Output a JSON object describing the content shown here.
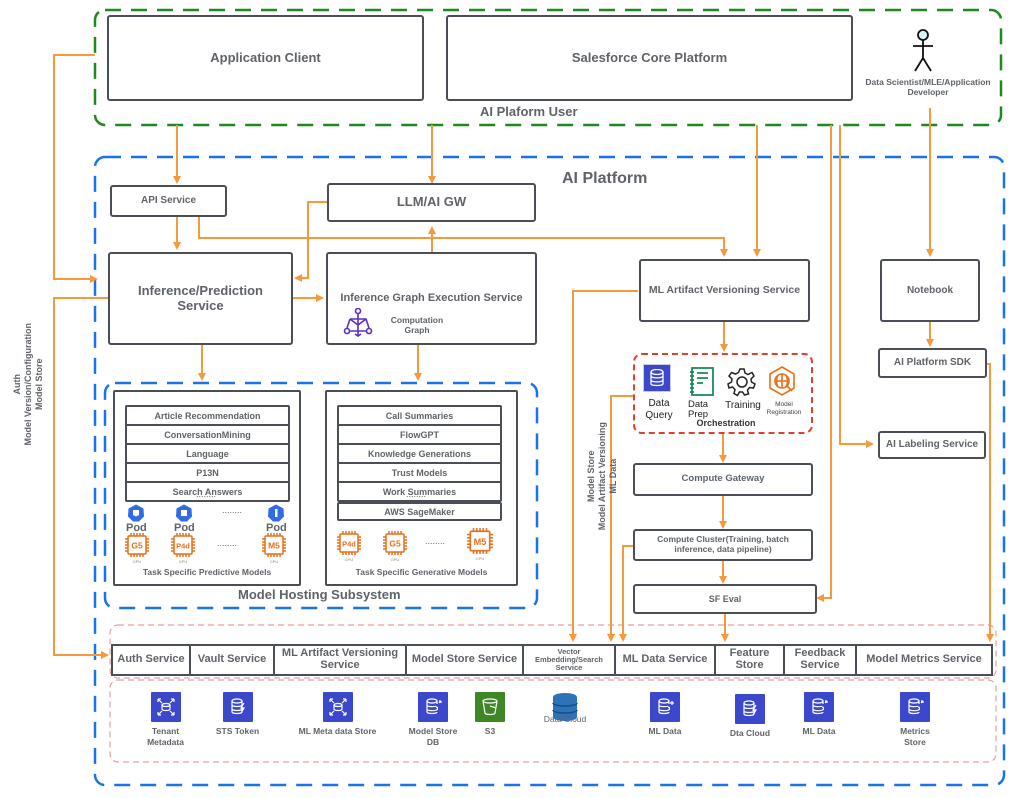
{
  "colors": {
    "user_boundary": "#1e8a1e",
    "platform_boundary": "#1a73e8",
    "connector": "#f7993a",
    "orchestration_border": "#e0402a",
    "data_layer_border": "#e8a0a0",
    "box_border": "#4a4f57",
    "text": "#5f6368",
    "aws_blue": "#3b48cc",
    "aws_green": "#3f8624",
    "chip_orange": "#e8701a",
    "pod_blue": "#326ce5",
    "graph_purple": "#5a2ec5"
  },
  "user_zone": {
    "title": "AI Plaform User",
    "application_client": "Application Client",
    "salesforce_core": "Salesforce Core Platform",
    "actor_icon": "person-icon",
    "actor_label": "Data Scientist/MLE/Application Developer"
  },
  "platform": {
    "title": "AI Platform",
    "api_service": "API Service",
    "llm_gw": "LLM/AI GW",
    "inference_service": "Inference/Prediction Service",
    "graph_execution": "Inference Graph Execution Service",
    "computation_graph_icon": "computation-graph-icon",
    "computation_graph": "Computation Graph",
    "ml_artifact_versioning": "ML Artifact Versioning Service",
    "notebook": "Notebook",
    "sdk": "AI Platform SDK",
    "labeling": "AI Labeling Service",
    "orchestration": {
      "title": "Orchestration",
      "items": [
        {
          "icon": "database-icon",
          "label": "Data Query"
        },
        {
          "icon": "notebook-icon",
          "label": "Data Prep"
        },
        {
          "icon": "gear-icon",
          "label": "Training"
        },
        {
          "icon": "model-registration-icon",
          "label": "Model Registration"
        }
      ]
    },
    "compute_gateway": "Compute Gateway",
    "compute_cluster": "Compute Cluster(Training, batch inference, data pipeline)",
    "sf_eval": "SF Eval"
  },
  "model_hosting": {
    "title": "Model Hosting Subsystem",
    "predictive": {
      "title": "Task Specific Predictive Models",
      "models": [
        "Article Recommendation",
        "ConversationMining",
        "Language",
        "P13N",
        "Search Answers"
      ],
      "ellipsis": "........",
      "pods": [
        "Pod",
        "Pod",
        "Pod"
      ],
      "chips": [
        {
          "name": "G5",
          "sub": "GPU"
        },
        {
          "name": "P4d",
          "sub": "GPU"
        },
        {
          "name": "M5",
          "sub": "CPU"
        }
      ]
    },
    "generative": {
      "title": "Task Specific Generative Models",
      "models": [
        "Call Summaries",
        "FlowGPT",
        "Knowledge Generations",
        "Trust Models",
        "Work Summaries"
      ],
      "ellipsis": "........",
      "sagemaker": "AWS SageMaker",
      "chips": [
        {
          "name": "P4d",
          "sub": "GPU"
        },
        {
          "name": "G5",
          "sub": "GPU"
        },
        {
          "name": "M5",
          "sub": "CPU"
        }
      ]
    }
  },
  "side_labels": {
    "left": [
      "Auth",
      "Model Version/Configuration",
      "Model Store"
    ],
    "middle": [
      "Model Store",
      "Model Artifact Versioning",
      "ML Data"
    ]
  },
  "services": [
    "Auth Service",
    "Vault Service",
    "ML Artifact Versioning Service",
    "Model Store Service",
    "Vector Embedding/Search Service",
    "ML Data Service",
    "Feature Store",
    "Feedback Service",
    "Model Metrics Service"
  ],
  "stores": [
    {
      "icon": "tenant-metadata-icon",
      "label": "Tenant Metadata"
    },
    {
      "icon": "sts-token-icon",
      "label": "STS Token"
    },
    {
      "icon": "ml-metadata-store-icon",
      "label": "ML Meta data Store"
    },
    {
      "icon": "model-store-db-icon",
      "label": "Model Store DB"
    },
    {
      "icon": "s3-bucket-icon",
      "label": "S3"
    },
    {
      "icon": "data-cloud-icon",
      "label": "Data Cloud"
    },
    {
      "icon": "ml-data-icon",
      "label": "ML Data"
    },
    {
      "icon": "dta-cloud-icon",
      "label": "Dta Cloud"
    },
    {
      "icon": "ml-data-icon",
      "label": "ML Data"
    },
    {
      "icon": "metrics-store-icon",
      "label": "Metrics Store"
    }
  ]
}
